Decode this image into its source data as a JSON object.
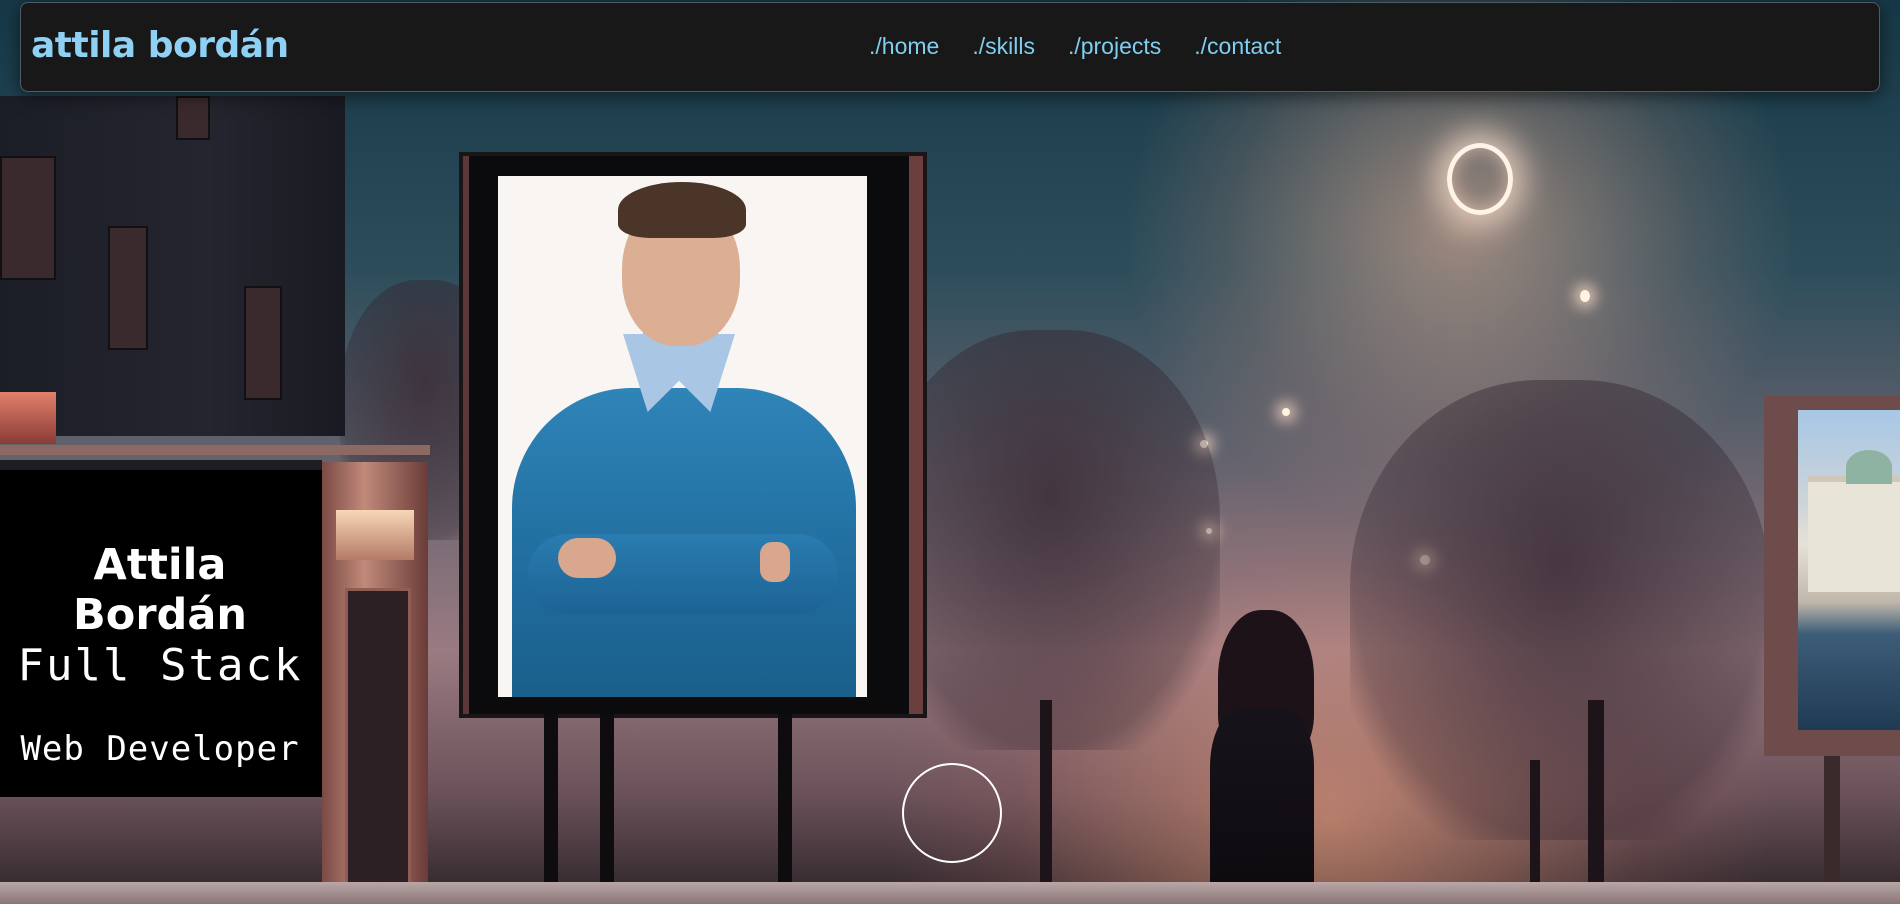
{
  "navbar": {
    "brand": "attila bordán",
    "links": [
      {
        "label": "./home"
      },
      {
        "label": "./skills"
      },
      {
        "label": "./projects"
      },
      {
        "label": "./contact"
      }
    ]
  },
  "hero": {
    "sign": {
      "name": "Attila Bordán",
      "role_line1": "Full Stack",
      "role_line2": "Web Developer"
    }
  },
  "colors": {
    "accent": "#8fd1f4",
    "navbar_bg": "#181818"
  }
}
